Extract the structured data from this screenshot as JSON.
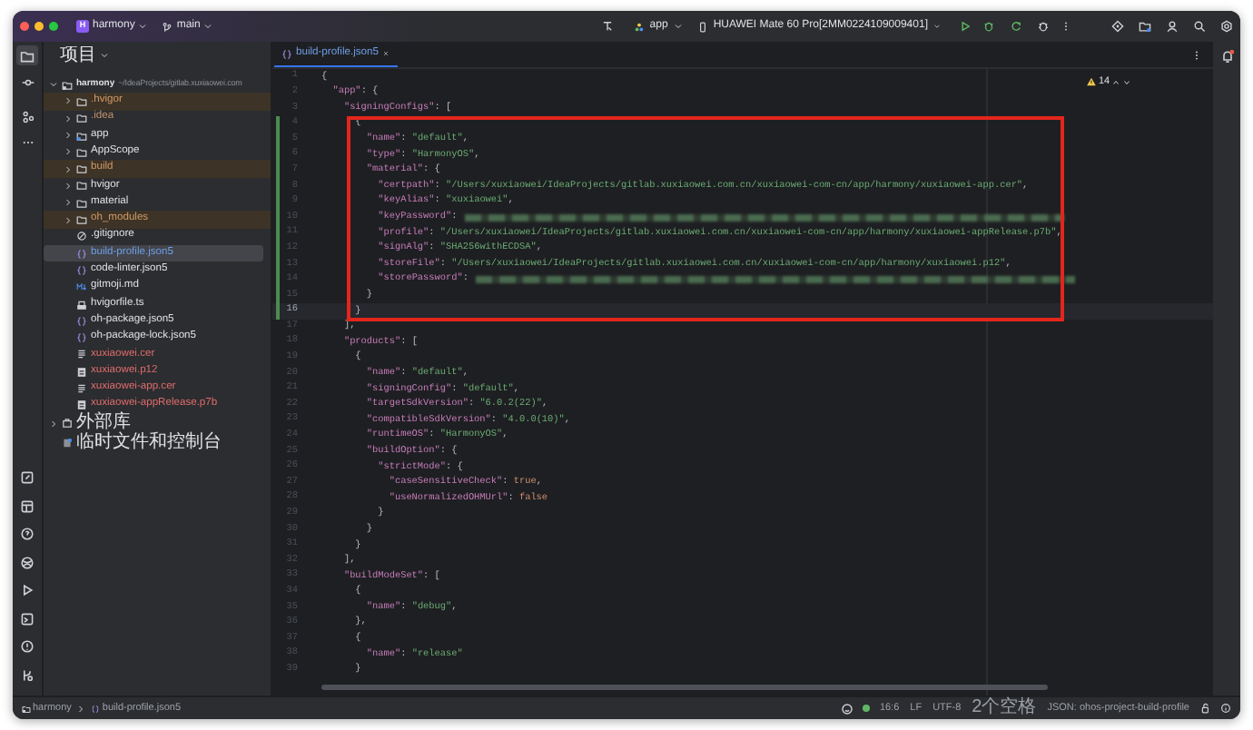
{
  "title_bar": {
    "project_badge": "H",
    "project": "harmony",
    "branch": "main",
    "run_config": "app",
    "device": "HUAWEI Mate 60 Pro[2MM0224109009401]"
  },
  "project_panel": {
    "title": "项目",
    "tree": [
      {
        "name": "harmony",
        "path": "~/IdeaProjects/gitlab.xuxiaowei.com",
        "kind": "project",
        "expanded": true,
        "selected": false,
        "excluded": false,
        "color": "#dfe1e5",
        "children": [
          {
            "name": ".hvigor",
            "kind": "folder",
            "expanded": false,
            "selected": false,
            "excluded": true,
            "color": "#d19a66"
          },
          {
            "name": ".idea",
            "kind": "folder",
            "expanded": false,
            "selected": false,
            "excluded": false,
            "color": "#c8916a"
          },
          {
            "name": "app",
            "kind": "module",
            "expanded": false,
            "selected": false,
            "excluded": false,
            "color": "#dfe1e5"
          },
          {
            "name": "AppScope",
            "kind": "folder",
            "expanded": false,
            "selected": false,
            "excluded": false,
            "color": "#dfe1e5"
          },
          {
            "name": "build",
            "kind": "folder",
            "expanded": false,
            "selected": false,
            "excluded": true,
            "color": "#d19a66"
          },
          {
            "name": "hvigor",
            "kind": "folder",
            "expanded": false,
            "selected": false,
            "excluded": false,
            "color": "#dfe1e5"
          },
          {
            "name": "material",
            "kind": "folder",
            "expanded": false,
            "selected": false,
            "excluded": false,
            "color": "#dfe1e5"
          },
          {
            "name": "oh_modules",
            "kind": "folder",
            "expanded": false,
            "selected": false,
            "excluded": true,
            "color": "#d19a66"
          },
          {
            "name": ".gitignore",
            "kind": "ignore",
            "selected": false,
            "excluded": false,
            "color": "#dfe1e5"
          },
          {
            "name": "build-profile.json5",
            "kind": "json",
            "selected": true,
            "excluded": false,
            "color": "#6f9fe8"
          },
          {
            "name": "code-linter.json5",
            "kind": "json",
            "selected": false,
            "excluded": false,
            "color": "#dfe1e5"
          },
          {
            "name": "gitmoji.md",
            "kind": "markdown",
            "selected": false,
            "excluded": false,
            "color": "#dfe1e5"
          },
          {
            "name": "hvigorfile.ts",
            "kind": "script",
            "selected": false,
            "excluded": false,
            "color": "#dfe1e5"
          },
          {
            "name": "oh-package.json5",
            "kind": "json",
            "selected": false,
            "excluded": false,
            "color": "#dfe1e5"
          },
          {
            "name": "oh-package-lock.json5",
            "kind": "json",
            "selected": false,
            "excluded": false,
            "color": "#dfe1e5"
          },
          {
            "name": "xuxiaowei.cer",
            "kind": "text",
            "selected": false,
            "excluded": false,
            "color": "#e06c6c"
          },
          {
            "name": "xuxiaowei.p12",
            "kind": "binary",
            "selected": false,
            "excluded": false,
            "color": "#e06c6c"
          },
          {
            "name": "xuxiaowei-app.cer",
            "kind": "text",
            "selected": false,
            "excluded": false,
            "color": "#e06c6c"
          },
          {
            "name": "xuxiaowei-appRelease.p7b",
            "kind": "binary",
            "selected": false,
            "excluded": false,
            "color": "#e06c6c"
          }
        ]
      },
      {
        "name": "外部库",
        "kind": "library",
        "expanded": false,
        "selected": false,
        "excluded": false,
        "color": "#dfe1e5"
      },
      {
        "name": "临时文件和控制台",
        "kind": "scratch",
        "selected": false,
        "excluded": false,
        "color": "#dfe1e5"
      }
    ]
  },
  "editor": {
    "tabs": [
      {
        "label": "build-profile.json5",
        "selected": true
      }
    ],
    "problems": "14",
    "lines": [
      {
        "number": "1",
        "text": "{",
        "changed": false,
        "current": false,
        "masked": false
      },
      {
        "number": "2",
        "text": "  \"app\": {",
        "changed": false,
        "current": false,
        "masked": false
      },
      {
        "number": "3",
        "text": "    \"signingConfigs\": [",
        "changed": false,
        "current": false,
        "masked": false
      },
      {
        "number": "4",
        "text": "      {",
        "changed": true,
        "current": false,
        "masked": false
      },
      {
        "number": "5",
        "text": "        \"name\": \"default\",",
        "changed": true,
        "current": false,
        "masked": false
      },
      {
        "number": "6",
        "text": "        \"type\": \"HarmonyOS\",",
        "changed": true,
        "current": false,
        "masked": false
      },
      {
        "number": "7",
        "text": "        \"material\": {",
        "changed": true,
        "current": false,
        "masked": false
      },
      {
        "number": "8",
        "text": "          \"certpath\": \"/Users/xuxiaowei/IdeaProjects/gitlab.xuxiaowei.com.cn/xuxiaowei-com-cn/app/harmony/xuxiaowei-app.cer\",",
        "changed": true,
        "current": false,
        "masked": false
      },
      {
        "number": "9",
        "text": "          \"keyAlias\": \"xuxiaowei\",",
        "changed": true,
        "current": false,
        "masked": false
      },
      {
        "number": "10",
        "text": "          \"keyPassword\":",
        "changed": true,
        "current": false,
        "masked": true
      },
      {
        "number": "11",
        "text": "          \"profile\": \"/Users/xuxiaowei/IdeaProjects/gitlab.xuxiaowei.com.cn/xuxiaowei-com-cn/app/harmony/xuxiaowei-appRelease.p7b\",",
        "changed": true,
        "current": false,
        "masked": false
      },
      {
        "number": "12",
        "text": "          \"signAlg\": \"SHA256withECDSA\",",
        "changed": true,
        "current": false,
        "masked": false
      },
      {
        "number": "13",
        "text": "          \"storeFile\": \"/Users/xuxiaowei/IdeaProjects/gitlab.xuxiaowei.com.cn/xuxiaowei-com-cn/app/harmony/xuxiaowei.p12\",",
        "changed": true,
        "current": false,
        "masked": false
      },
      {
        "number": "14",
        "text": "          \"storePassword\":",
        "changed": true,
        "current": false,
        "masked": true
      },
      {
        "number": "15",
        "text": "        }",
        "changed": true,
        "current": false,
        "masked": false
      },
      {
        "number": "16",
        "text": "      }",
        "changed": true,
        "current": true,
        "masked": false
      },
      {
        "number": "17",
        "text": "    ],",
        "changed": false,
        "current": false,
        "masked": false
      },
      {
        "number": "18",
        "text": "    \"products\": [",
        "changed": false,
        "current": false,
        "masked": false
      },
      {
        "number": "19",
        "text": "      {",
        "changed": false,
        "current": false,
        "masked": false
      },
      {
        "number": "20",
        "text": "        \"name\": \"default\",",
        "changed": false,
        "current": false,
        "masked": false
      },
      {
        "number": "21",
        "text": "        \"signingConfig\": \"default\",",
        "changed": false,
        "current": false,
        "masked": false
      },
      {
        "number": "22",
        "text": "        \"targetSdkVersion\": \"6.0.2(22)\",",
        "changed": false,
        "current": false,
        "masked": false
      },
      {
        "number": "23",
        "text": "        \"compatibleSdkVersion\": \"4.0.0(10)\",",
        "changed": false,
        "current": false,
        "masked": false
      },
      {
        "number": "24",
        "text": "        \"runtimeOS\": \"HarmonyOS\",",
        "changed": false,
        "current": false,
        "masked": false
      },
      {
        "number": "25",
        "text": "        \"buildOption\": {",
        "changed": false,
        "current": false,
        "masked": false
      },
      {
        "number": "26",
        "text": "          \"strictMode\": {",
        "changed": false,
        "current": false,
        "masked": false
      },
      {
        "number": "27",
        "text": "            \"caseSensitiveCheck\": true,",
        "changed": false,
        "current": false,
        "masked": false
      },
      {
        "number": "28",
        "text": "            \"useNormalizedOHMUrl\": false",
        "changed": false,
        "current": false,
        "masked": false
      },
      {
        "number": "29",
        "text": "          }",
        "changed": false,
        "current": false,
        "masked": false
      },
      {
        "number": "30",
        "text": "        }",
        "changed": false,
        "current": false,
        "masked": false
      },
      {
        "number": "31",
        "text": "      }",
        "changed": false,
        "current": false,
        "masked": false
      },
      {
        "number": "32",
        "text": "    ],",
        "changed": false,
        "current": false,
        "masked": false
      },
      {
        "number": "33",
        "text": "    \"buildModeSet\": [",
        "changed": false,
        "current": false,
        "masked": false
      },
      {
        "number": "34",
        "text": "      {",
        "changed": false,
        "current": false,
        "masked": false
      },
      {
        "number": "35",
        "text": "        \"name\": \"debug\",",
        "changed": false,
        "current": false,
        "masked": false
      },
      {
        "number": "36",
        "text": "      },",
        "changed": false,
        "current": false,
        "masked": false
      },
      {
        "number": "37",
        "text": "      {",
        "changed": false,
        "current": false,
        "masked": false
      },
      {
        "number": "38",
        "text": "        \"name\": \"release\"",
        "changed": false,
        "current": false,
        "masked": false
      },
      {
        "number": "39",
        "text": "      }",
        "changed": false,
        "current": false,
        "masked": false
      }
    ]
  },
  "status_bar": {
    "breadcrumbs": [
      "harmony",
      "build-profile.json5"
    ],
    "position": "16:6",
    "line_separator": "LF",
    "encoding": "UTF-8",
    "indent": "2个空格",
    "schema": "JSON: ohos-project-build-profile"
  }
}
